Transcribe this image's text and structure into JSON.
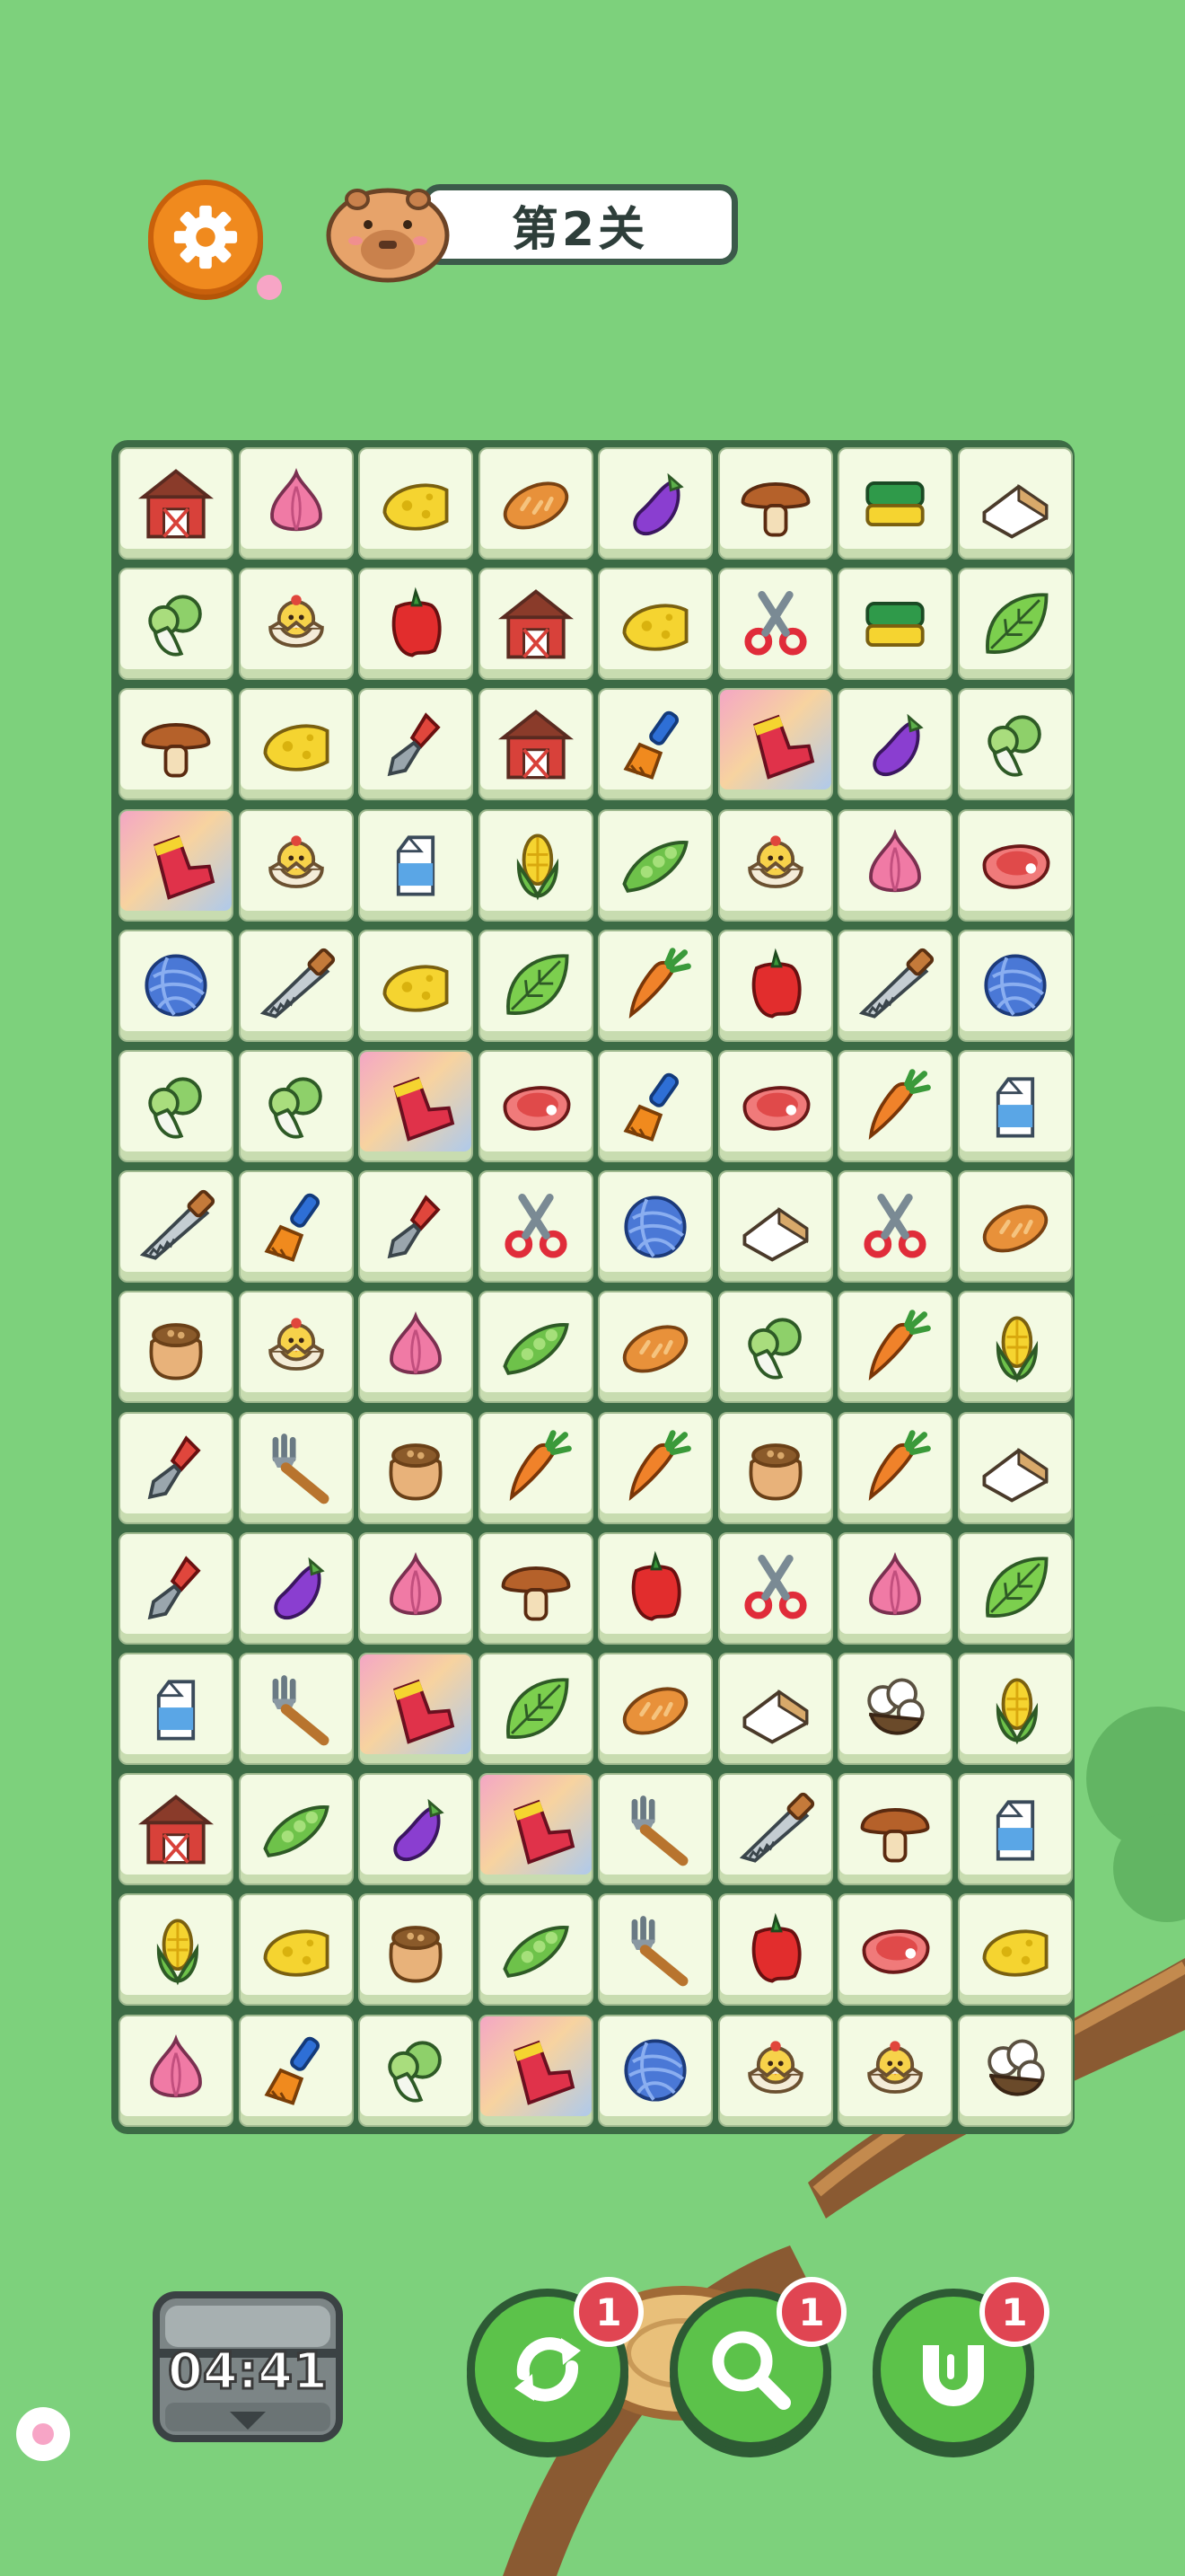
{
  "header": {
    "level_label": "第2关"
  },
  "hud": {
    "timer": "04:41"
  },
  "tools": [
    {
      "name": "shuffle",
      "icon": "shuffle-icon",
      "count": "1"
    },
    {
      "name": "hint",
      "icon": "magnifier-icon",
      "count": "1"
    },
    {
      "name": "magnet",
      "icon": "magnet-icon",
      "count": "1"
    }
  ],
  "colors": {
    "background": "#7dd17c",
    "board": "#3c6b45",
    "tile": "#f3fae3",
    "badge": "#e04552",
    "settings": "#f08a1e"
  },
  "board": {
    "columns": 8,
    "rows": 14,
    "tiles": [
      [
        "barn",
        "onion",
        "cheese",
        "bread",
        "eggplant",
        "mushroom",
        "sponge",
        "toast"
      ],
      [
        "cabbage",
        "chick",
        "pepper",
        "barn",
        "cheese",
        "shears",
        "sponge",
        "leaf"
      ],
      [
        "mushroom",
        "cheese",
        "trowel",
        "barn",
        "brush",
        "boot",
        "eggplant",
        "cabbage"
      ],
      [
        "boot",
        "chick",
        "milk",
        "corn",
        "peas",
        "chick",
        "onion",
        "steak"
      ],
      [
        "yarn",
        "saw",
        "cheese",
        "leaf",
        "carrot",
        "pepper",
        "saw",
        "yarn"
      ],
      [
        "cabbage",
        "cabbage",
        "boot",
        "steak",
        "brush",
        "steak",
        "carrot",
        "milk"
      ],
      [
        "saw",
        "brush",
        "trowel",
        "shears",
        "yarn",
        "toast",
        "shears",
        "bread"
      ],
      [
        "sack",
        "chick",
        "onion",
        "peas",
        "bread",
        "cabbage",
        "carrot",
        "corn"
      ],
      [
        "trowel",
        "fork",
        "sack",
        "carrot",
        "carrot",
        "sack",
        "carrot",
        "toast"
      ],
      [
        "trowel",
        "eggplant",
        "onion",
        "mushroom",
        "pepper",
        "shears",
        "onion",
        "leaf"
      ],
      [
        "milk",
        "fork",
        "boot",
        "leaf",
        "bread",
        "toast",
        "cauliflower",
        "corn"
      ],
      [
        "barn",
        "peas",
        "eggplant",
        "boot",
        "fork",
        "saw",
        "mushroom",
        "milk"
      ],
      [
        "corn",
        "cheese",
        "sack",
        "peas",
        "fork",
        "pepper",
        "steak",
        "cheese"
      ],
      [
        "onion",
        "brush",
        "cabbage",
        "boot",
        "yarn",
        "chick",
        "chick",
        "cauliflower"
      ]
    ],
    "highlighted": [
      [
        2,
        5
      ],
      [
        3,
        0
      ],
      [
        5,
        2
      ],
      [
        10,
        2
      ],
      [
        11,
        3
      ],
      [
        13,
        3
      ]
    ]
  }
}
